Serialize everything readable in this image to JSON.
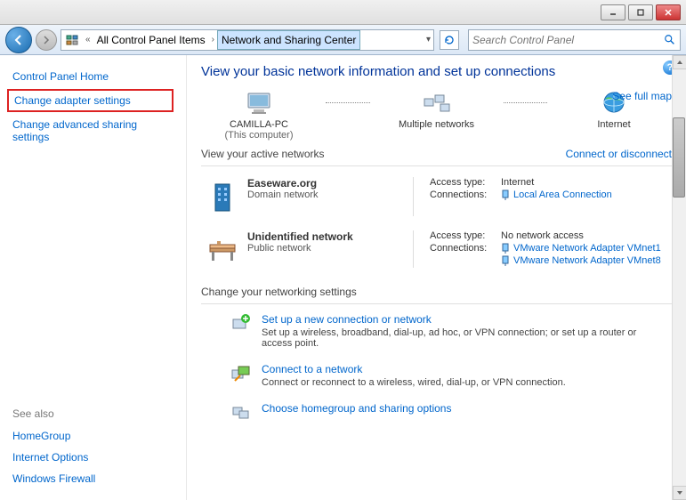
{
  "breadcrumb": {
    "item1": "All Control Panel Items",
    "item2": "Network and Sharing Center"
  },
  "search": {
    "placeholder": "Search Control Panel"
  },
  "sidebar": {
    "home": "Control Panel Home",
    "adapter": "Change adapter settings",
    "advanced": "Change advanced sharing settings"
  },
  "seealso": {
    "header": "See also",
    "items": [
      "HomeGroup",
      "Internet Options",
      "Windows Firewall"
    ]
  },
  "page": {
    "title": "View your basic network information and set up connections",
    "seefullmap": "See full map",
    "map": {
      "computer": "CAMILLA-PC",
      "computer_sub": "(This computer)",
      "middle": "Multiple networks",
      "internet": "Internet"
    },
    "active_label": "View your active networks",
    "connect_disconnect": "Connect or disconnect",
    "networks": [
      {
        "name": "Easeware.org",
        "type": "Domain network",
        "access_label": "Access type:",
        "access_value": "Internet",
        "conn_label": "Connections:",
        "connections": [
          "Local Area Connection"
        ]
      },
      {
        "name": "Unidentified network",
        "type": "Public network",
        "access_label": "Access type:",
        "access_value": "No network access",
        "conn_label": "Connections:",
        "connections": [
          "VMware Network Adapter VMnet1",
          "VMware Network Adapter VMnet8"
        ]
      }
    ],
    "change_label": "Change your networking settings",
    "settings": [
      {
        "title": "Set up a new connection or network",
        "desc": "Set up a wireless, broadband, dial-up, ad hoc, or VPN connection; or set up a router or access point."
      },
      {
        "title": "Connect to a network",
        "desc": "Connect or reconnect to a wireless, wired, dial-up, or VPN connection."
      },
      {
        "title": "Choose homegroup and sharing options",
        "desc": ""
      }
    ]
  }
}
